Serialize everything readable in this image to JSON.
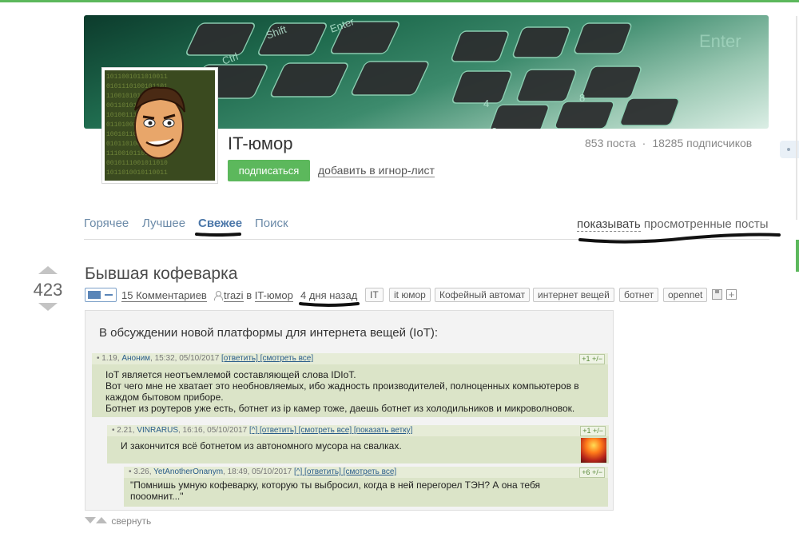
{
  "community": {
    "name": "IT-юмор",
    "subscribe_label": "подписаться",
    "ignore_label": "добавить в игнор-лист",
    "posts_count": "853 поста",
    "subscribers_count": "18285 подписчиков"
  },
  "tabs": [
    {
      "label": "Горячее",
      "active": false
    },
    {
      "label": "Лучшее",
      "active": false
    },
    {
      "label": "Свежее",
      "active": true
    },
    {
      "label": "Поиск",
      "active": false
    }
  ],
  "show_viewed": {
    "link": "показывать",
    "rest": " просмотренные посты"
  },
  "post": {
    "rating": "423",
    "title": "Бывшая кофеварка",
    "comments": "15 Комментариев",
    "author": "trazi",
    "in_word": "в",
    "community": "IT-юмор",
    "time": "4 дня назад",
    "tags": [
      "IT",
      "it юмор",
      "Кофейный автомат",
      "интернет вещей",
      "ботнет",
      "opennet"
    ],
    "intro": "В обсуждении новой платформы для интернета вещей (IoT):",
    "comments_image": [
      {
        "meta": "1.19, ",
        "name": "Аноним",
        "time": ", 15:32, 05/10/2017 ",
        "links": "[ответить] [смотреть все]",
        "vote": "+1 +/−",
        "lines": [
          "IoT является неотъемлемой составляющей слова IDIoT.",
          "Вот чего мне не хватает это необновляемых, ибо жадность производителей, полноценных компьютеров в",
          "каждом бытовом приборе.",
          "Ботнет из роутеров уже есть, ботнет из ip камер тоже, даешь ботнет из холодильников и микроволновок."
        ]
      },
      {
        "meta": "2.21, ",
        "name": "VINRARUS",
        "time": ", 16:16, 05/10/2017 ",
        "links": "[^] [ответить] [смотреть все] [показать ветку]",
        "vote": "+1 +/−",
        "lines": [
          "И закончится всё ботнетом из автономного мусора на свалках."
        ]
      },
      {
        "meta": "3.26, ",
        "name": "YetAnotherOnanym",
        "time": ", 18:49, 05/10/2017 ",
        "links": "[^] [ответить] [смотреть все]",
        "vote": "+6 +/−",
        "lines": [
          "\"Помнишь умную кофеварку, которую ты выбросил, когда в ней перегорел ТЭН? А она тебя",
          "пооомнит...\""
        ]
      }
    ],
    "collapse_label": "свернуть"
  },
  "colors": {
    "accent_green": "#5cb85c",
    "link_blue": "#4a76a8",
    "comment_bg": "#dbe4c8"
  }
}
